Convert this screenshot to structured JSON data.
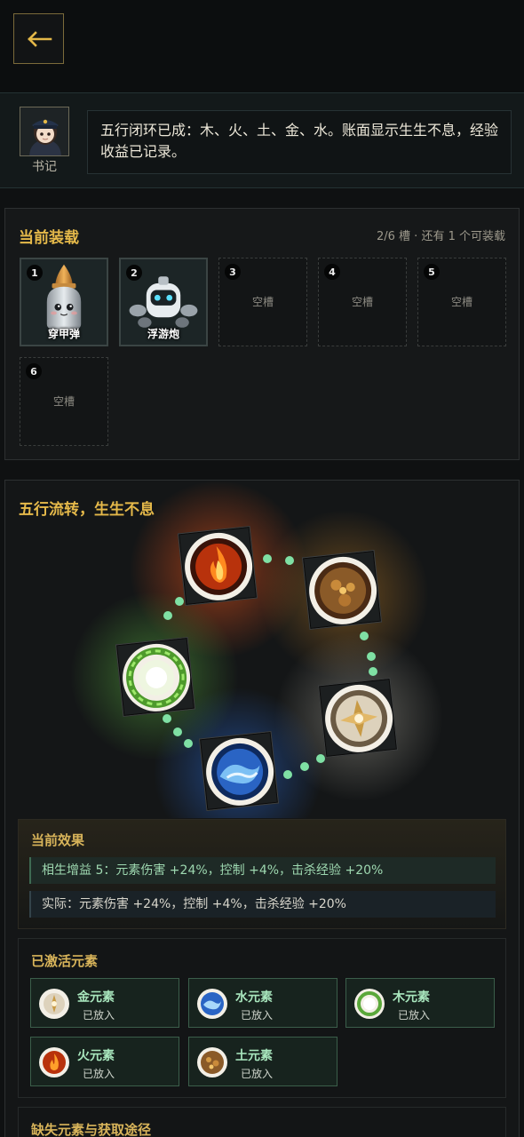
{
  "header": {
    "back_icon": "arrow-left-icon"
  },
  "clerk": {
    "name": "书记",
    "message": "五行闭环已成：木、火、土、金、水。账面显示生生不息，经验收益已记录。"
  },
  "loadout": {
    "title": "当前装载",
    "summary": "2/6 槽 · 还有 1 个可装载",
    "slots": [
      {
        "num": "1",
        "label": "穿甲弹",
        "state": "filled",
        "icon": "armor-piercing-shell-icon"
      },
      {
        "num": "2",
        "label": "浮游炮",
        "state": "filled",
        "icon": "floating-drone-icon"
      },
      {
        "num": "3",
        "label": "空槽",
        "state": "empty"
      },
      {
        "num": "4",
        "label": "空槽",
        "state": "empty"
      },
      {
        "num": "5",
        "label": "空槽",
        "state": "empty"
      },
      {
        "num": "6",
        "label": "空槽",
        "state": "empty"
      }
    ]
  },
  "cycle": {
    "title": "五行流转，生生不息",
    "elements": [
      "fire-element-icon",
      "earth-element-icon",
      "metal-element-icon",
      "water-element-icon",
      "wood-element-icon"
    ]
  },
  "effect": {
    "title": "当前效果",
    "line1": "相生增益 5：元素伤害 +24%，控制 +4%，击杀经验 +20%",
    "line2": "实际：元素伤害 +24%，控制 +4%，击杀经验 +20%"
  },
  "active": {
    "title": "已激活元素",
    "items": [
      {
        "name": "金元素",
        "status": "已放入",
        "icon": "metal-element-icon"
      },
      {
        "name": "水元素",
        "status": "已放入",
        "icon": "water-element-icon"
      },
      {
        "name": "木元素",
        "status": "已放入",
        "icon": "wood-element-icon"
      },
      {
        "name": "火元素",
        "status": "已放入",
        "icon": "fire-element-icon"
      },
      {
        "name": "土元素",
        "status": "已放入",
        "icon": "earth-element-icon"
      }
    ]
  },
  "missing": {
    "title": "缺失元素与获取途径"
  },
  "colors": {
    "accent_gold": "#e5b94a",
    "active_green": "#a8e6bd",
    "path_dot": "#7fe0a4",
    "fire": "#ff6a1a",
    "earth": "#b8772a",
    "metal": "#e8dcc4",
    "water": "#3c7fd8",
    "wood": "#8ad460"
  }
}
